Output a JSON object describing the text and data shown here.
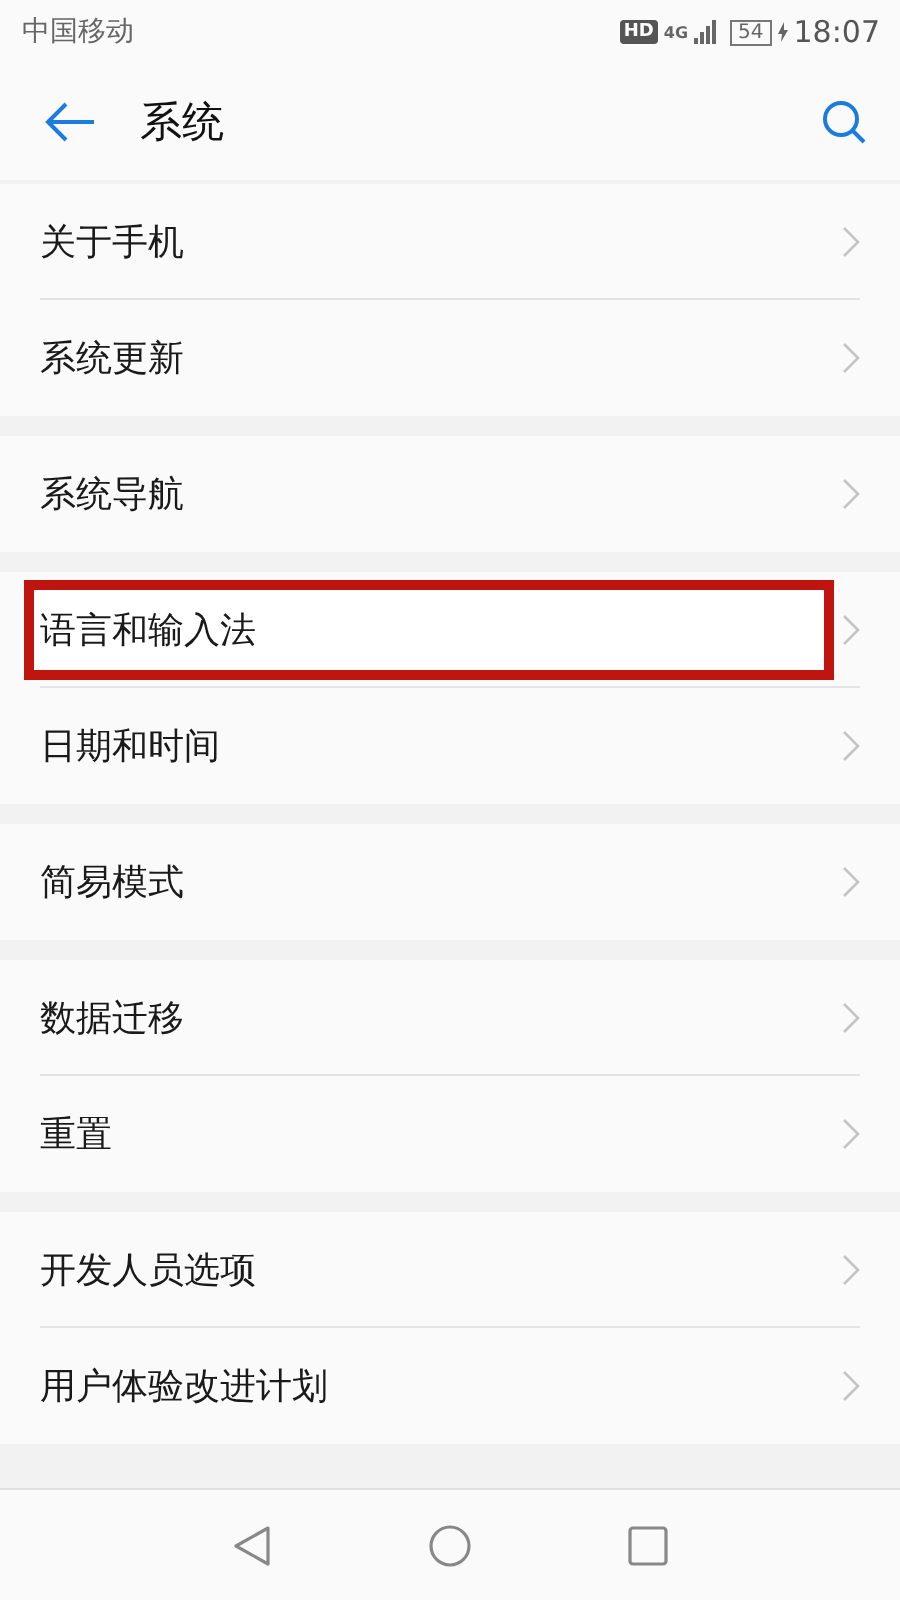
{
  "status_bar": {
    "carrier": "中国移动",
    "hd": "HD",
    "network": "4G",
    "battery": "54",
    "time": "18:07"
  },
  "header": {
    "title": "系统"
  },
  "groups": [
    {
      "items": [
        {
          "label": "关于手机",
          "highlighted": false
        },
        {
          "label": "系统更新",
          "highlighted": false
        }
      ]
    },
    {
      "items": [
        {
          "label": "系统导航",
          "highlighted": false
        }
      ]
    },
    {
      "items": [
        {
          "label": "语言和输入法",
          "highlighted": true
        },
        {
          "label": "日期和时间",
          "highlighted": false
        }
      ]
    },
    {
      "items": [
        {
          "label": "简易模式",
          "highlighted": false
        }
      ]
    },
    {
      "items": [
        {
          "label": "数据迁移",
          "highlighted": false
        },
        {
          "label": "重置",
          "highlighted": false
        }
      ]
    },
    {
      "items": [
        {
          "label": "开发人员选项",
          "highlighted": false
        },
        {
          "label": "用户体验改进计划",
          "highlighted": false
        }
      ]
    }
  ]
}
